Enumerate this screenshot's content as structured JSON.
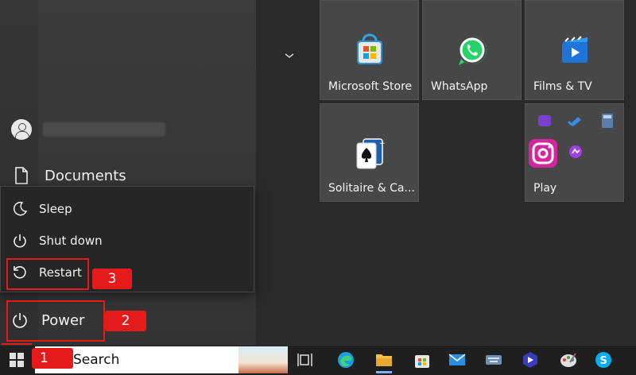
{
  "user": {
    "name": ""
  },
  "left": {
    "documents_label": "Documents",
    "power_label": "Power",
    "power_menu": [
      {
        "label": "Sleep",
        "icon": "moon-icon"
      },
      {
        "label": "Shut down",
        "icon": "power-icon"
      },
      {
        "label": "Restart",
        "icon": "restart-icon"
      }
    ]
  },
  "tiles": [
    {
      "label": "Microsoft Store",
      "icon": "store-icon"
    },
    {
      "label": "WhatsApp",
      "icon": "whatsapp-icon"
    },
    {
      "label": "Films & TV",
      "icon": "films-tv-icon"
    },
    {
      "label": "Solitaire & Ca...",
      "icon": "solitaire-icon"
    },
    {
      "label": "Play",
      "icon": "play-folder-icon"
    }
  ],
  "annotations": {
    "step_1": "1",
    "step_2": "2",
    "step_3": "3"
  },
  "taskbar": {
    "search_label": "Search",
    "apps": [
      "task-view-icon",
      "edge-icon",
      "file-explorer-icon",
      "store-icon",
      "mail-icon",
      "keyboard-icon",
      "video-icon",
      "paint-icon",
      "skype-icon"
    ]
  },
  "colors": {
    "accent_red": "#e51b1b",
    "tile_bg": "#474747",
    "taskbar_bg": "#1f1f1f"
  }
}
